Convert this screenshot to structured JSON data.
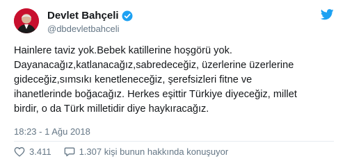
{
  "author": {
    "name": "Devlet Bahçeli",
    "handle": "@dbdevletbahceli"
  },
  "tweet": {
    "lines": [
      "Hainlere taviz yok.Bebek katillerine hoşgörü yok.",
      "Dayanacağız,katlanacağız,sabredeceğiz, üzerlerine üzerlerine",
      "gideceğiz,sımsıkı kenetleneceğiz, şerefsizleri fitne ve",
      "ihanetlerinde boğacağız. Herkes eşittir Türkiye diyeceğiz, millet",
      "birdir, o da Türk milletidir diye haykıracağız."
    ],
    "timestamp": "18:23 - 1 Ağu 2018"
  },
  "actions": {
    "likes": "3.411",
    "replies_label": "1.307 kişi bunun hakkında konuşuyor"
  },
  "colors": {
    "brand": "#1da1f2",
    "text": "#14171a",
    "muted": "#657786",
    "divider": "#e6ecf0"
  },
  "icons": [
    "verified-badge-icon",
    "twitter-bird-icon",
    "heart-icon",
    "comment-icon"
  ]
}
